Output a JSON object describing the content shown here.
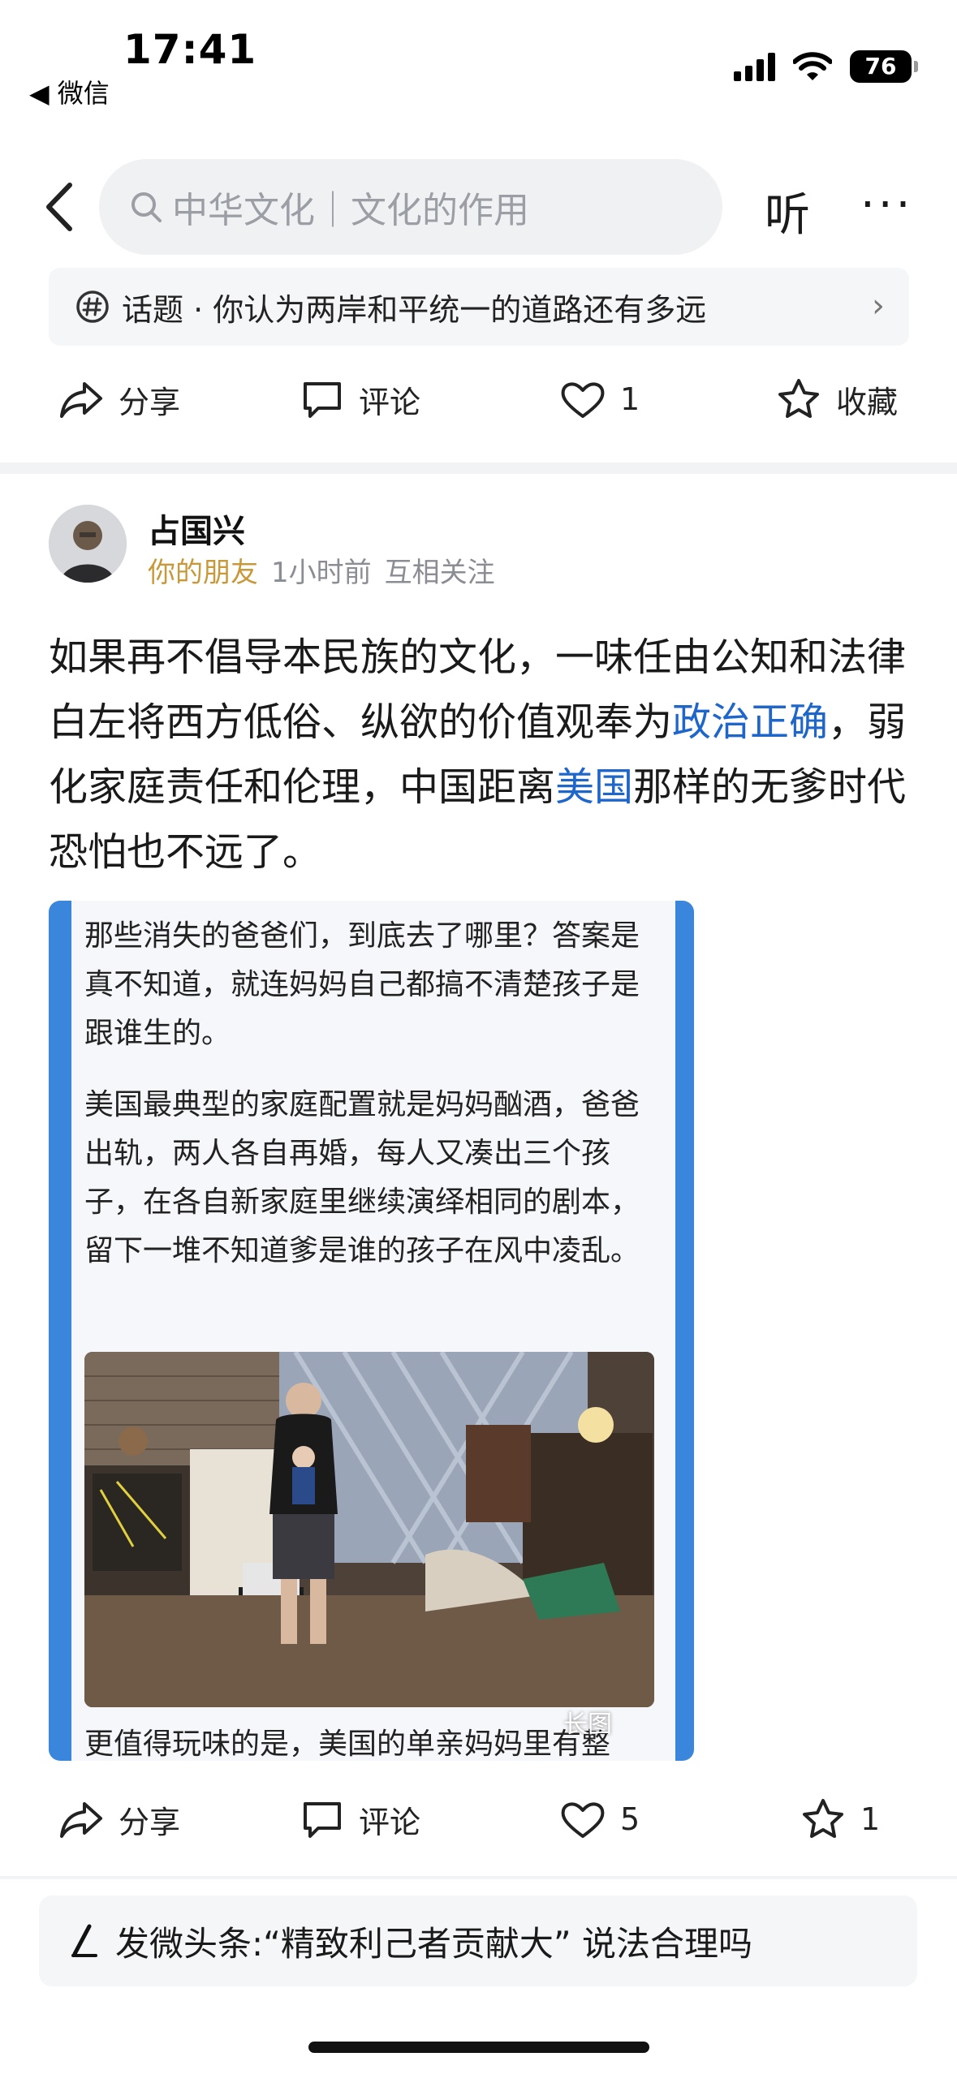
{
  "status_bar": {
    "time": "17:41",
    "back_app": "◀ 微信",
    "battery": "76"
  },
  "nav": {
    "search_text": "中华文化｜文化的作用",
    "listen_label": "听",
    "more_label": "···"
  },
  "topic": {
    "text": "话题 · 你认为两岸和平统一的道路还有多远"
  },
  "top_actions": {
    "share_label": "分享",
    "comment_label": "评论",
    "like_count": "1",
    "collect_label": "收藏"
  },
  "post": {
    "author_name": "占国兴",
    "friend_tag": "你的朋友",
    "time_ago": "1小时前",
    "relation": "互相关注",
    "body_part1": "如果再不倡导本民族的文化，一味任由公知和法律白左将西方低俗、纵欲的价值观奉为",
    "link1": "政治正确",
    "body_part2": "，弱化家庭责任和伦理，中国距离",
    "link2": "美国",
    "body_part3": "那样的无爹时代恐怕也不远了。",
    "embed_para1": "那些消失的爸爸们，到底去了哪里？答案是真不知道，就连妈妈自己都搞不清楚孩子是跟谁生的。",
    "embed_para2": "美国最典型的家庭配置就是妈妈酗酒，爸爸出轨，两人各自再婚，每人又凑出三个孩子，在各自新家庭里继续演绎相同的剧本，留下一堆不知道爹是谁的孩子在风中凌乱。",
    "embed_cut": "更值得玩味的是，美国的单亲妈妈里有整",
    "long_image_tag": "长图"
  },
  "bottom_actions": {
    "share_label": "分享",
    "comment_label": "评论",
    "like_count": "5",
    "star_count": "1"
  },
  "compose": {
    "text": "发微头条:“精致利己者贡献大” 说法合理吗"
  },
  "colors": {
    "link": "#1e66c9",
    "friend_tag": "#c8993a",
    "embed_border": "#3b86dd"
  }
}
